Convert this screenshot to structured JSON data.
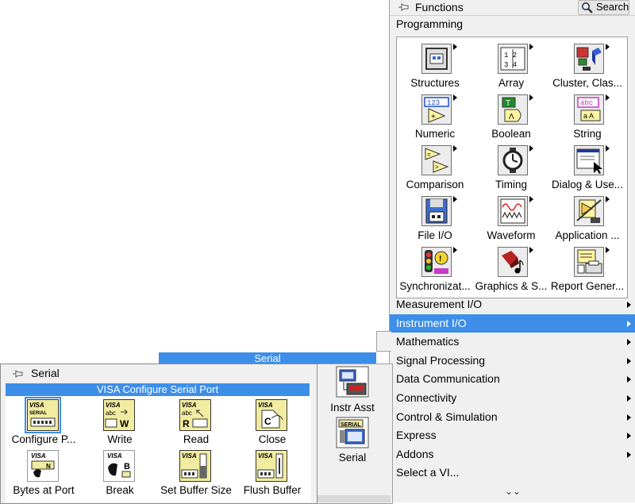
{
  "functions": {
    "title": "Functions",
    "search_label": "Search",
    "programming_label": "Programming",
    "programming_items": [
      {
        "label": "Structures",
        "icon": "structures-icon"
      },
      {
        "label": "Array",
        "icon": "array-icon"
      },
      {
        "label": "Cluster, Clas...",
        "icon": "cluster-icon"
      },
      {
        "label": "Numeric",
        "icon": "numeric-icon"
      },
      {
        "label": "Boolean",
        "icon": "boolean-icon"
      },
      {
        "label": "String",
        "icon": "string-icon"
      },
      {
        "label": "Comparison",
        "icon": "comparison-icon"
      },
      {
        "label": "Timing",
        "icon": "timing-icon"
      },
      {
        "label": "Dialog & Use...",
        "icon": "dialog-icon"
      },
      {
        "label": "File I/O",
        "icon": "file-io-icon"
      },
      {
        "label": "Waveform",
        "icon": "waveform-icon"
      },
      {
        "label": "Application ...",
        "icon": "application-control-icon"
      },
      {
        "label": "Synchronizat...",
        "icon": "synchronization-icon"
      },
      {
        "label": "Graphics & S...",
        "icon": "graphics-sound-icon"
      },
      {
        "label": "Report Gener...",
        "icon": "report-generation-icon"
      }
    ],
    "categories": [
      {
        "label": "Measurement I/O",
        "has_arrow": true,
        "selected": false
      },
      {
        "label": "Instrument I/O",
        "has_arrow": true,
        "selected": true
      },
      {
        "label": "Mathematics",
        "has_arrow": true,
        "selected": false
      },
      {
        "label": "Signal Processing",
        "has_arrow": true,
        "selected": false
      },
      {
        "label": "Data Communication",
        "has_arrow": true,
        "selected": false
      },
      {
        "label": "Connectivity",
        "has_arrow": true,
        "selected": false
      },
      {
        "label": "Control & Simulation",
        "has_arrow": true,
        "selected": false
      },
      {
        "label": "Express",
        "has_arrow": true,
        "selected": false
      },
      {
        "label": "Addons",
        "has_arrow": true,
        "selected": false
      },
      {
        "label": "Select a VI...",
        "has_arrow": false,
        "selected": false
      }
    ],
    "more_glyph": "⌄⌄"
  },
  "instrument_io": {
    "hover_label": "Serial",
    "items": [
      {
        "label": "Instr Asst",
        "icon": "instrument-assistant-icon"
      },
      {
        "label": "Serial",
        "icon": "serial-icon"
      }
    ]
  },
  "serial": {
    "title": "Serial",
    "tooltip": "VISA Configure Serial Port",
    "items": [
      {
        "label": "Configure P...",
        "icon": "visa-configure-serial-port-icon",
        "selected": true
      },
      {
        "label": "Write",
        "icon": "visa-write-icon",
        "selected": false
      },
      {
        "label": "Read",
        "icon": "visa-read-icon",
        "selected": false
      },
      {
        "label": "Close",
        "icon": "visa-close-icon",
        "selected": false
      },
      {
        "label": "Bytes at Port",
        "icon": "visa-bytes-at-port-icon",
        "selected": false
      },
      {
        "label": "Break",
        "icon": "visa-break-icon",
        "selected": false
      },
      {
        "label": "Set Buffer Size",
        "icon": "visa-set-buffer-size-icon",
        "selected": false
      },
      {
        "label": "Flush Buffer",
        "icon": "visa-flush-buffer-icon",
        "selected": false
      }
    ]
  },
  "colors": {
    "selection": "#3d8ee8",
    "palette_bg": "#f0f0f0",
    "visa_icon_bg": "#f2eca0"
  }
}
